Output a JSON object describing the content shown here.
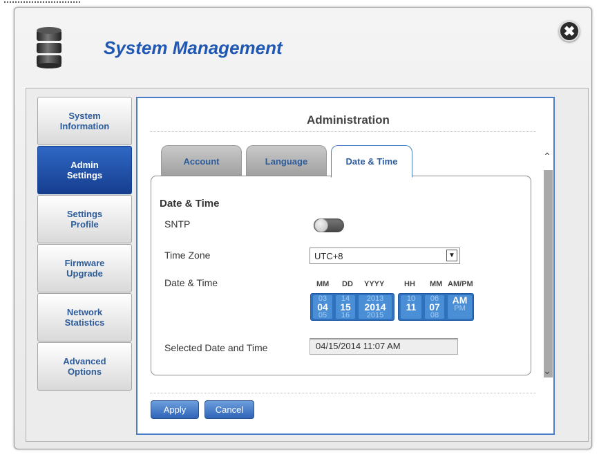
{
  "dialog": {
    "title": "System Management",
    "close_label": "✖"
  },
  "sidebar": {
    "items": [
      {
        "label": "System\nInformation",
        "active": false
      },
      {
        "label": "Admin\nSettings",
        "active": true
      },
      {
        "label": "Settings\nProfile",
        "active": false
      },
      {
        "label": "Firmware\nUpgrade",
        "active": false
      },
      {
        "label": "Network\nStatistics",
        "active": false
      },
      {
        "label": "Advanced\nOptions",
        "active": false
      }
    ]
  },
  "main": {
    "heading": "Administration",
    "tabs": [
      {
        "label": "Account",
        "active": false
      },
      {
        "label": "Language",
        "active": false
      },
      {
        "label": "Date & Time",
        "active": true
      }
    ],
    "section_title": "Date & Time",
    "sntp": {
      "label": "SNTP",
      "enabled": false
    },
    "time_zone": {
      "label": "Time Zone",
      "value": "UTC+8"
    },
    "date_time": {
      "label": "Date & Time",
      "headers": {
        "month": "MM",
        "day": "DD",
        "year": "YYYY",
        "hour": "HH",
        "minute": "MM",
        "ampm": "AM/PM"
      },
      "month": {
        "prev": "03",
        "cur": "04",
        "next": "05"
      },
      "day": {
        "prev": "14",
        "cur": "15",
        "next": "16"
      },
      "year": {
        "prev": "2013",
        "cur": "2014",
        "next": "2015"
      },
      "hour": {
        "prev": "10",
        "cur": "11",
        "next": ""
      },
      "minute": {
        "prev": "06",
        "cur": "07",
        "next": "08"
      },
      "ampm": {
        "prev": "",
        "cur": "AM",
        "next": "PM"
      }
    },
    "selected": {
      "label": "Selected Date and Time",
      "value": "04/15/2014 11:07 AM"
    }
  },
  "footer": {
    "apply_label": "Apply",
    "cancel_label": "Cancel"
  },
  "colors": {
    "accent": "#1f57b3",
    "active_nav": "#1e4ea5",
    "panel_border": "#4a7dc7",
    "picker": "#2f71bf"
  },
  "icons": {
    "header": "database-icon",
    "close": "close-icon",
    "scroll_up": "chevron-up-icon",
    "scroll_down": "chevron-down-icon",
    "select": "dropdown-arrow-icon"
  }
}
